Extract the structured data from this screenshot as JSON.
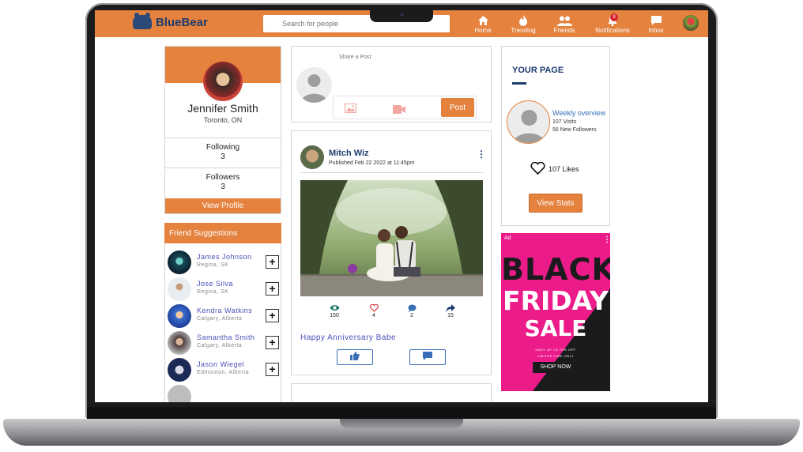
{
  "app": {
    "name": "BlueBear"
  },
  "header": {
    "search_placeholder": "Search for people",
    "nav": [
      {
        "label": "Home",
        "icon": "home-icon"
      },
      {
        "label": "Trending",
        "icon": "fire-icon"
      },
      {
        "label": "Friends",
        "icon": "users-icon"
      },
      {
        "label": "Notifications",
        "icon": "bell-icon",
        "badge": "9"
      },
      {
        "label": "Inbox",
        "icon": "chat-icon"
      }
    ]
  },
  "profile": {
    "name": "Jennifer Smith",
    "location": "Toronto, ON",
    "following_label": "Following",
    "following_count": "3",
    "followers_label": "Followers",
    "followers_count": "3",
    "view_profile_label": "View Profile"
  },
  "friend_suggestions": {
    "title": "Friend Suggestions",
    "items": [
      {
        "name": "James Johnson",
        "location": "Regina, SK"
      },
      {
        "name": "Jose Silva",
        "location": "Regina, SK"
      },
      {
        "name": "Kendra Watkins",
        "location": "Calgary, Alberta"
      },
      {
        "name": "Samantha Smith",
        "location": "Calgary, Alberta"
      },
      {
        "name": "Jason Wiegel",
        "location": "Edmonton, Alberta"
      }
    ],
    "add_label": "+"
  },
  "composer": {
    "placeholder": "Share a Post",
    "post_label": "Post"
  },
  "post": {
    "author": "Mitch Wiz",
    "published": "Published Feb 22 2022 at 11:45pm",
    "metrics": {
      "views": "150",
      "likes": "4",
      "comments": "2",
      "shares": "15"
    },
    "caption": "Happy Anniversary Babe"
  },
  "your_page": {
    "title": "YOUR PAGE",
    "weekly_title": "Weekly overview",
    "visits": "107 Visits",
    "new_followers": "56 New Followers",
    "likes": "107 Likes",
    "view_stats_label": "View Stats"
  },
  "ad": {
    "label": "Ad",
    "line1": "BLACK",
    "line2": "FRIDAY",
    "line3": "SALE",
    "small1": "EASY UP TO 70% OFF",
    "small2": "LIMITED TIME ONLY",
    "cta": "SHOP NOW"
  },
  "colors": {
    "brand": "#e4823e",
    "navy": "#1e3c6e",
    "link": "#4a4fb8",
    "ad_bg": "#ec1b8a"
  }
}
